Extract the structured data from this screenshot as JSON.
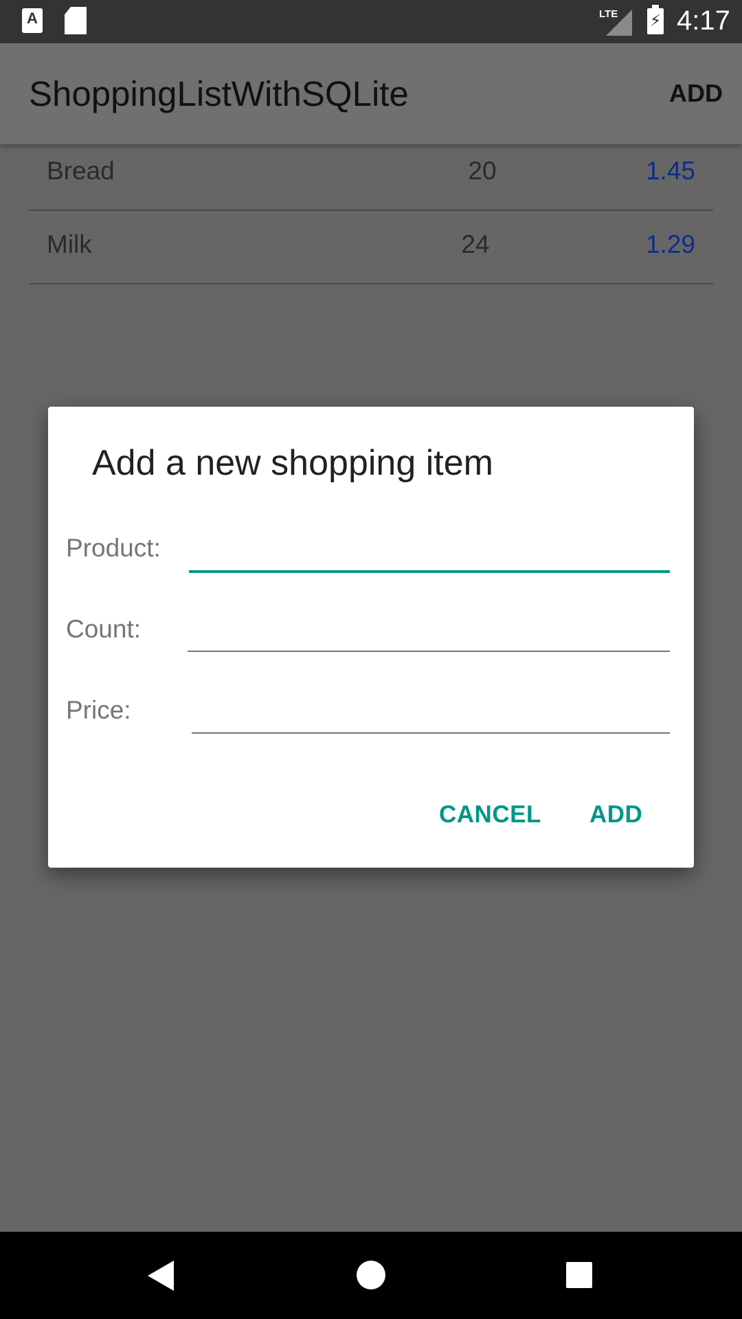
{
  "status_bar": {
    "time": "4:17",
    "network": "LTE",
    "icons": [
      "a-notification-icon",
      "sd-card-icon",
      "signal-icon",
      "battery-charging-icon"
    ]
  },
  "app_bar": {
    "title": "ShoppingListWithSQLite",
    "action_add": "ADD"
  },
  "shopping_list": [
    {
      "name": "Bread",
      "count": "20",
      "price": "1.45"
    },
    {
      "name": "Milk",
      "count": "24",
      "price": "1.29"
    }
  ],
  "dialog": {
    "title": "Add a new shopping item",
    "product_label": "Product:",
    "product_value": "",
    "count_label": "Count:",
    "count_value": "",
    "price_label": "Price:",
    "price_value": "",
    "cancel_label": "CANCEL",
    "add_label": "ADD"
  },
  "colors": {
    "accent": "#009688",
    "price_text": "#0d2d8a",
    "scrim_background": "#666666"
  },
  "nav_bar": {
    "icons": [
      "back-icon",
      "home-icon",
      "recents-icon"
    ]
  }
}
